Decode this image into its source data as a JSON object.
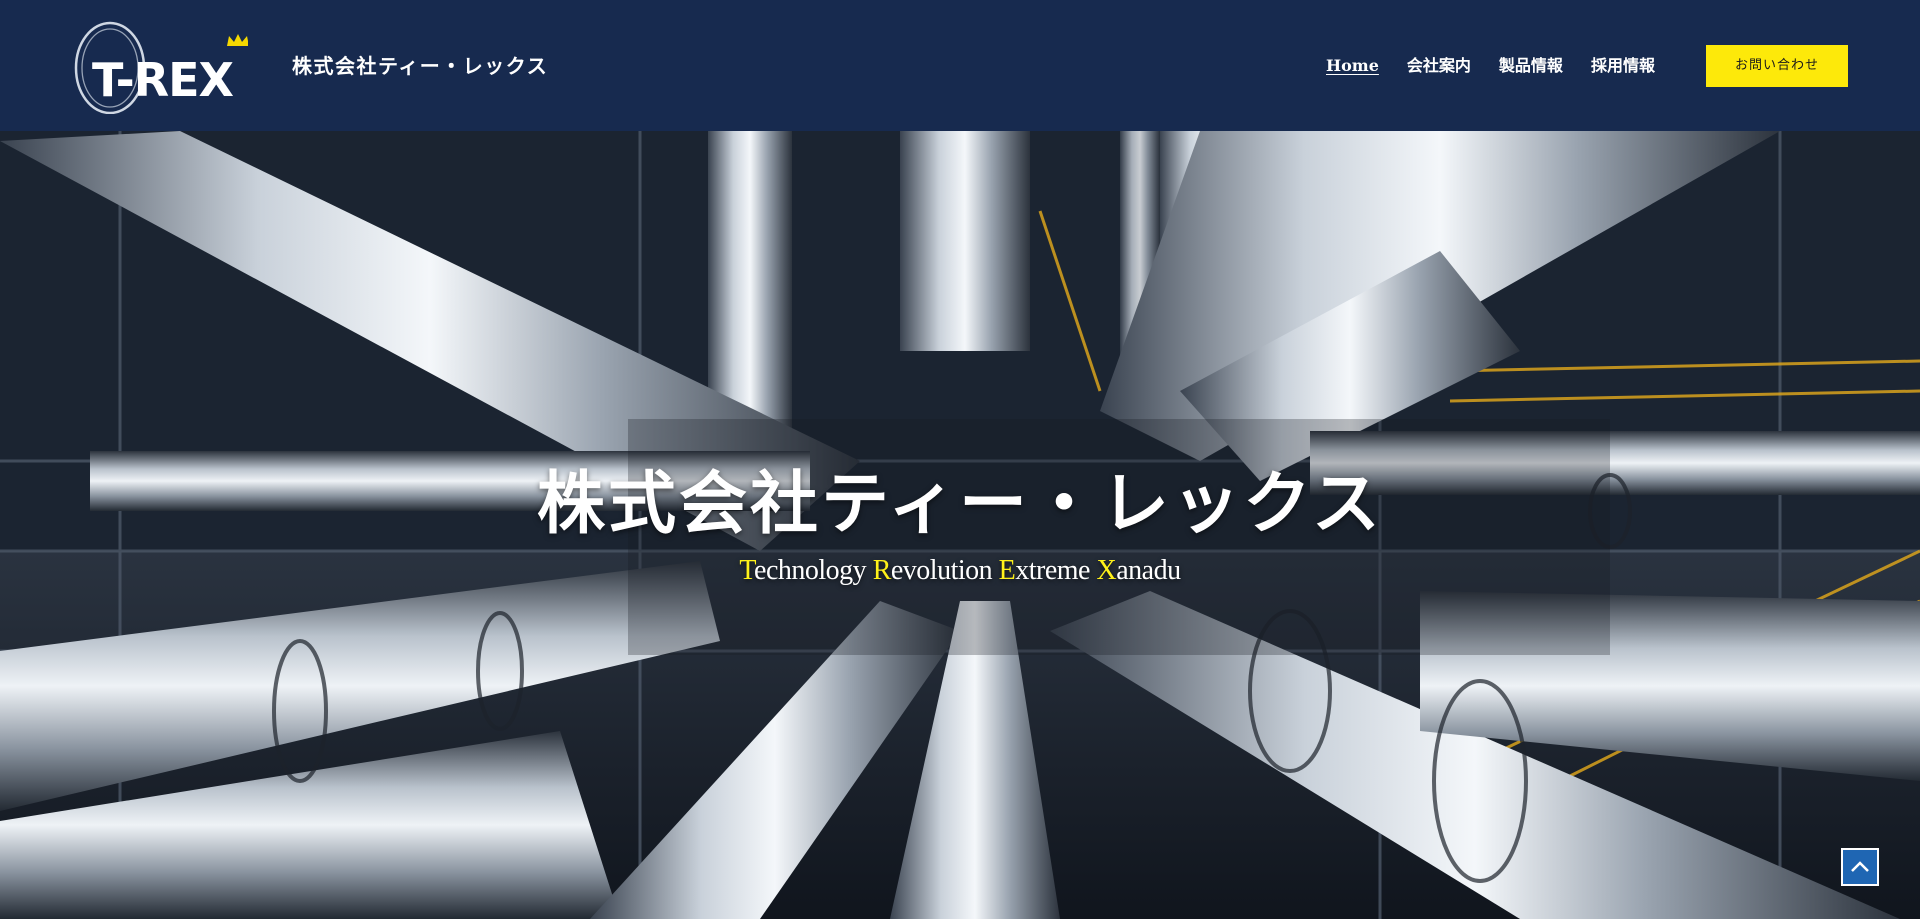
{
  "header": {
    "logo_text": "T-REX",
    "company_name": "株式会社ティー・レックス",
    "nav": [
      {
        "label": "Home",
        "active": true
      },
      {
        "label": "会社案内",
        "active": false
      },
      {
        "label": "製品情報",
        "active": false
      },
      {
        "label": "採用情報",
        "active": false
      }
    ],
    "contact_label": "お問い合わせ"
  },
  "hero": {
    "title": "株式会社ティー・レックス",
    "tagline_words": [
      {
        "initial": "T",
        "rest": "echnology"
      },
      {
        "initial": "R",
        "rest": "evolution"
      },
      {
        "initial": "E",
        "rest": "xtreme"
      },
      {
        "initial": "X",
        "rest": "anadu"
      }
    ],
    "background": "industrial-steel-pipes-image"
  },
  "scroll_top": {
    "icon": "chevron-up-icon"
  },
  "colors": {
    "header_bg": "#172a4f",
    "contact_button_bg": "#fde90a",
    "tagline_accent": "#fff21a",
    "scroll_button_bg": "#1f66b3"
  }
}
